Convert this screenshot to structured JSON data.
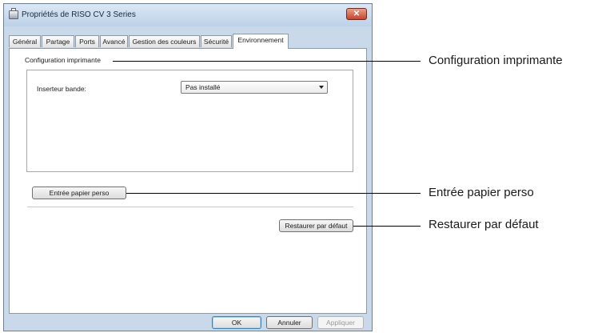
{
  "window": {
    "title": "Propriétés de RISO CV 3 Series",
    "close_glyph": "✕"
  },
  "tabs": [
    {
      "label": "Général"
    },
    {
      "label": "Partage"
    },
    {
      "label": "Ports"
    },
    {
      "label": "Avancé"
    },
    {
      "label": "Gestion des couleurs"
    },
    {
      "label": "Sécurité"
    },
    {
      "label": "Environnement",
      "active": true
    }
  ],
  "printer_config": {
    "group_label": "Configuration imprimante",
    "field_label": "Inserteur bande:",
    "select_value": "Pas installé"
  },
  "buttons": {
    "custom_paper": "Entrée papier perso",
    "restore_default": "Restaurer par défaut",
    "ok": "OK",
    "cancel": "Annuler",
    "apply": "Appliquer"
  },
  "callouts": {
    "printer_config": "Configuration imprimante",
    "custom_paper": "Entrée papier perso",
    "restore_default": "Restaurer par défaut"
  }
}
